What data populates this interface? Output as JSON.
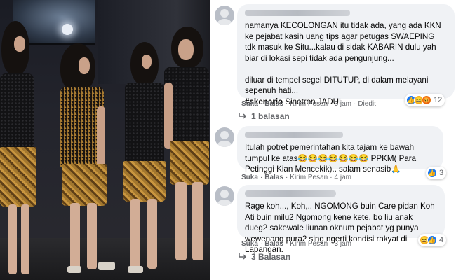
{
  "photo": {
    "alt_icon": "photo-of-people"
  },
  "comments": [
    {
      "text": "namanya KECOLONGAN itu tidak ada, yang ada KKN ke pejabat kasih uang tips agar petugas SWAEPING tdk masuk ke Situ...kalau di sidak KABARIN dulu yah biar di lokasi sepi tidak ada pengunjung...\n\ndiluar di tempel segel DITUTUP, di dalam melayani sepenuh hati...",
      "hashtag": "#skenario",
      "hashtag_rest": " Sinetron JADUL",
      "like": "Suka",
      "reply": "Balas",
      "send": "Kirim Pesan",
      "time": "3 jam",
      "edited": "Diedit",
      "reaction_count": "12",
      "reaction_icons": [
        "like-icon",
        "haha-icon",
        "angry-icon"
      ],
      "replies_label": "1 balasan"
    },
    {
      "text": "Itulah potret pemerintahan kita tajam ke bawah tumpul ke atas😂😂😂😂😂😂😂 PPKM( Para Petinggi Kian Mencekik).. salam senasib🙏",
      "like": "Suka",
      "reply": "Balas",
      "send": "Kirim Pesan",
      "time": "4 jam",
      "reaction_count": "3",
      "reaction_icons": [
        "like-icon"
      ]
    },
    {
      "text": "Rage koh..., Koh,.. NGOMONG buin Care pidan Koh Ati buin milu2 Ngomong kene kete, bo liu anak dueg2 sakewale liunan oknum pejabat yg punya wewenang pura2 sing ngerti kondisi rakyat di Lapangan.",
      "like": "Suka",
      "reply": "Balas",
      "send": "Kirim Pesan",
      "time": "3 jam",
      "reaction_count": "4",
      "reaction_icons": [
        "haha-icon",
        "like-icon"
      ],
      "replies_label": "3 Balasan"
    }
  ],
  "colors": {
    "bubble": "#f0f2f5",
    "meta": "#65676b",
    "text": "#050505",
    "like_blue": "#1877f2"
  }
}
